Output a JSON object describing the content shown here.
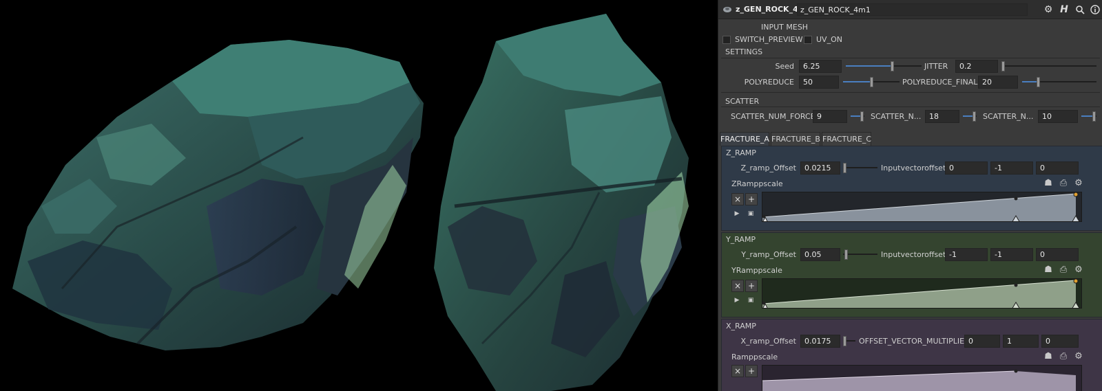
{
  "viewport": {
    "label": "3D viewport"
  },
  "titlebar": {
    "node_type": "z_GEN_ROCK_4m",
    "node_name": "z_GEN_ROCK_4m1",
    "icons": [
      "gear-icon",
      "houdini-help-icon",
      "search-icon",
      "info-icon"
    ]
  },
  "input_mesh": {
    "label": "INPUT MESH",
    "switch_preview": "SWITCH_PREVIEW",
    "uv_on": "UV_ON"
  },
  "settings": {
    "header": "SETTINGS",
    "seed_label": "Seed",
    "seed_value": "6.25",
    "seed_fraction": 0.62,
    "jitter_label": "JITTER",
    "jitter_value": "0.2",
    "jitter_fraction": 0.0,
    "polyreduce_label": "POLYREDUCE",
    "polyreduce_value": "50",
    "polyreduce_fraction": 0.5,
    "polyreduce_final_label": "POLYREDUCE_FINAL",
    "polyreduce_final_value": "20",
    "polyreduce_final_fraction": 0.2
  },
  "scatter": {
    "header": "SCATTER",
    "force_label": "SCATTER_NUM_FORCE",
    "force_value": "9",
    "n2_label": "SCATTER_N...",
    "n2_value": "18",
    "n3_label": "SCATTER_N...",
    "n3_value": "10"
  },
  "tabs": [
    "FRACTURE_A",
    "FRACTURE_B",
    "FRACTURE_C"
  ],
  "z_ramp": {
    "header": "Z_RAMP",
    "offset_label": "Z_ramp_Offset",
    "offset_value": "0.0215",
    "vector_label": "Inputvectoroffset",
    "vector": [
      "0",
      "-1",
      "0"
    ],
    "ramp_label": "ZRamppscale",
    "color": "#2f3a48"
  },
  "y_ramp": {
    "header": "Y_RAMP",
    "offset_label": "Y_ramp_Offset",
    "offset_value": "0.05",
    "vector_label": "Inputvectoroffset",
    "vector": [
      "-1",
      "-1",
      "0"
    ],
    "ramp_label": "YRamppscale",
    "color": "#34442f"
  },
  "x_ramp": {
    "header": "X_RAMP",
    "offset_label": "X_ramp_Offset",
    "offset_value": "0.0175",
    "vector_label": "OFFSET_VECTOR_MULTIPLIER",
    "vector": [
      "0",
      "1",
      "0"
    ],
    "ramp_label": "Ramppscale",
    "color": "#3e3546"
  },
  "ramp_controls": {
    "remove": "×",
    "add": "+"
  }
}
